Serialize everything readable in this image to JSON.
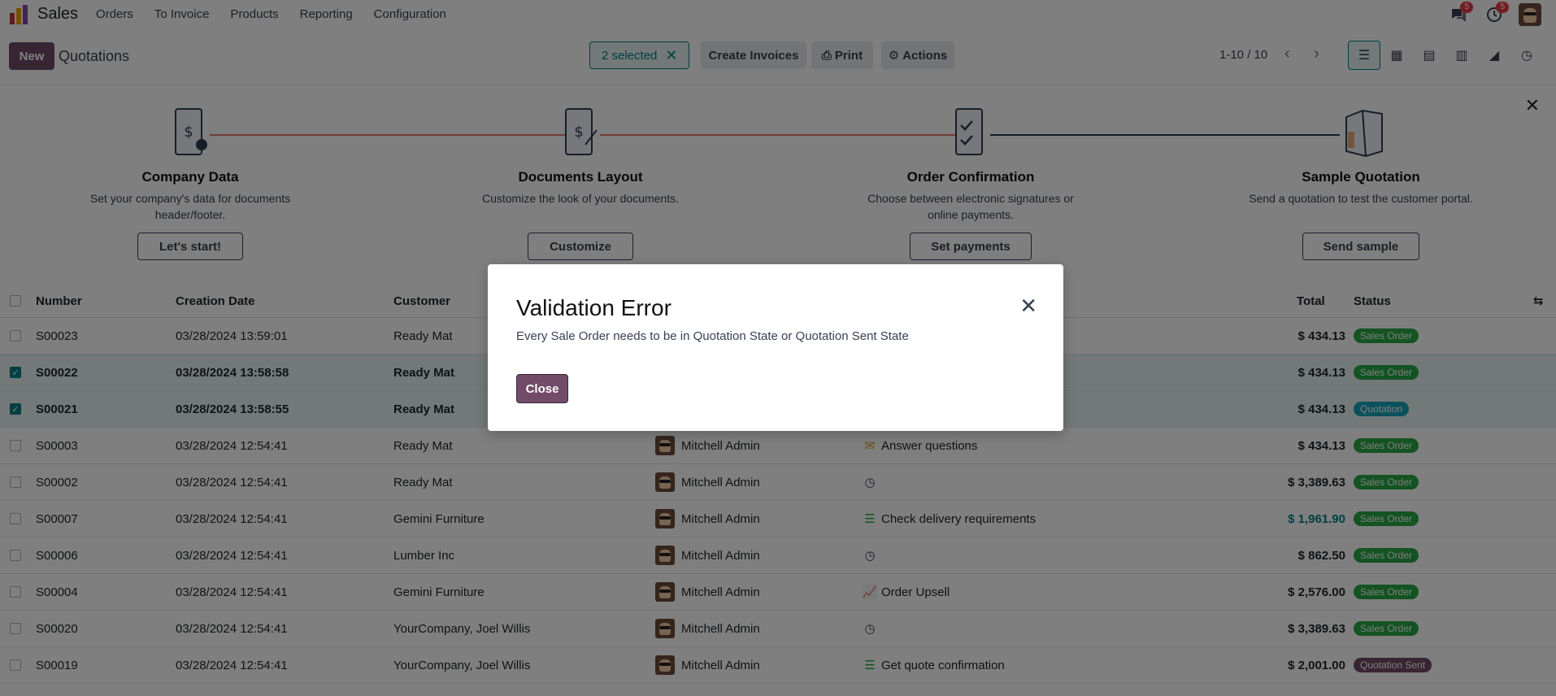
{
  "app": {
    "name": "Sales"
  },
  "menu": [
    "Orders",
    "To Invoice",
    "Products",
    "Reporting",
    "Configuration"
  ],
  "nav_badges": {
    "messages": "5",
    "activities": "5"
  },
  "control": {
    "new_label": "New",
    "title": "Quotations",
    "selected_label": "2 selected",
    "create_invoices": "Create Invoices",
    "print": "Print",
    "actions": "Actions",
    "pager": "1-10 / 10"
  },
  "onboarding": {
    "steps": [
      {
        "title": "Company Data",
        "desc": "Set your company's data for documents header/footer.",
        "button": "Let's start!"
      },
      {
        "title": "Documents Layout",
        "desc": "Customize the look of your documents.",
        "button": "Customize"
      },
      {
        "title": "Order Confirmation",
        "desc": "Choose between electronic signatures or online payments.",
        "button": "Set payments"
      },
      {
        "title": "Sample Quotation",
        "desc": "Send a quotation to test the customer portal.",
        "button": "Send sample"
      }
    ]
  },
  "table": {
    "headers": {
      "number": "Number",
      "creation_date": "Creation Date",
      "customer": "Customer",
      "total": "Total",
      "status": "Status"
    },
    "rows": [
      {
        "number": "S00023",
        "date": "03/28/2024 13:59:01",
        "customer": "Ready Mat",
        "salesperson": "",
        "activity": "",
        "activity_icon": "",
        "total": "$ 434.13",
        "status": "Sales Order",
        "status_color": "#28a745",
        "selected": false
      },
      {
        "number": "S00022",
        "date": "03/28/2024 13:58:58",
        "customer": "Ready Mat",
        "salesperson": "",
        "activity": "",
        "activity_icon": "",
        "total": "$ 434.13",
        "status": "Sales Order",
        "status_color": "#28a745",
        "selected": true
      },
      {
        "number": "S00021",
        "date": "03/28/2024 13:58:55",
        "customer": "Ready Mat",
        "salesperson": "",
        "activity": "",
        "activity_icon": "",
        "total": "$ 434.13",
        "status": "Quotation",
        "status_color": "#17a2b8",
        "selected": true
      },
      {
        "number": "S00003",
        "date": "03/28/2024 12:54:41",
        "customer": "Ready Mat",
        "salesperson": "Mitchell Admin",
        "activity": "Answer questions",
        "activity_icon": "envelope-icon",
        "total": "$ 434.13",
        "status": "Sales Order",
        "status_color": "#28a745",
        "selected": false
      },
      {
        "number": "S00002",
        "date": "03/28/2024 12:54:41",
        "customer": "Ready Mat",
        "salesperson": "Mitchell Admin",
        "activity": "",
        "activity_icon": "clock-icon",
        "total": "$ 3,389.63",
        "status": "Sales Order",
        "status_color": "#28a745",
        "selected": false
      },
      {
        "number": "S00007",
        "date": "03/28/2024 12:54:41",
        "customer": "Gemini Furniture",
        "salesperson": "Mitchell Admin",
        "activity": "Check delivery requirements",
        "activity_icon": "tasks-icon",
        "total": "$ 1,961.90",
        "status": "Sales Order",
        "status_color": "#28a745",
        "selected": false,
        "total_highlight": true
      },
      {
        "number": "S00006",
        "date": "03/28/2024 12:54:41",
        "customer": "Lumber Inc",
        "salesperson": "Mitchell Admin",
        "activity": "",
        "activity_icon": "clock-icon",
        "total": "$ 862.50",
        "status": "Sales Order",
        "status_color": "#28a745",
        "selected": false
      },
      {
        "number": "S00004",
        "date": "03/28/2024 12:54:41",
        "customer": "Gemini Furniture",
        "salesperson": "Mitchell Admin",
        "activity": "Order Upsell",
        "activity_icon": "chart-line-icon",
        "total": "$ 2,576.00",
        "status": "Sales Order",
        "status_color": "#28a745",
        "selected": false
      },
      {
        "number": "S00020",
        "date": "03/28/2024 12:54:41",
        "customer": "YourCompany, Joel Willis",
        "salesperson": "Mitchell Admin",
        "activity": "",
        "activity_icon": "clock-icon",
        "total": "$ 3,389.63",
        "status": "Sales Order",
        "status_color": "#28a745",
        "selected": false
      },
      {
        "number": "S00019",
        "date": "03/28/2024 12:54:41",
        "customer": "YourCompany, Joel Willis",
        "salesperson": "Mitchell Admin",
        "activity": "Get quote confirmation",
        "activity_icon": "tasks-icon",
        "total": "$ 2,001.00",
        "status": "Quotation Sent",
        "status_color": "#714b67",
        "selected": false
      }
    ]
  },
  "dialog": {
    "title": "Validation Error",
    "message": "Every Sale Order needs to be in Quotation State or Quotation Sent State",
    "close_label": "Close"
  }
}
